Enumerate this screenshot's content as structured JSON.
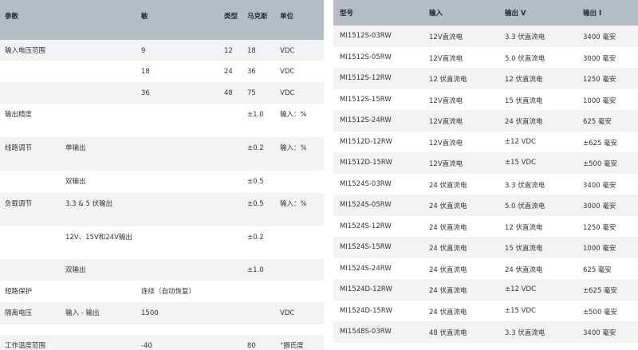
{
  "left_table": {
    "headers": [
      "参数",
      "",
      "敏",
      "类型",
      "马克斯",
      "单位"
    ],
    "rows": [
      [
        "输入电压范围",
        "",
        "9",
        "12",
        "18",
        "VDC"
      ],
      [
        "",
        "",
        "18",
        "24",
        "36",
        "VDC"
      ],
      [
        "",
        "",
        "36",
        "48",
        "75",
        "VDC"
      ],
      [
        "输出精度",
        "",
        "",
        "",
        "±1.0",
        "输入：%"
      ],
      [
        "线路调节",
        "单输出",
        "",
        "",
        "±0.2",
        "输入：%"
      ],
      [
        "",
        "双输出",
        "",
        "",
        "±0.5",
        ""
      ],
      [
        "负载调节",
        "3.3 & 5 伏输出",
        "",
        "",
        "±0.5",
        "输入：%"
      ],
      [
        "",
        "12V、15V和24V输出",
        "",
        "",
        "±0.2",
        ""
      ],
      [
        "",
        "双输出",
        "",
        "",
        "±1.0",
        ""
      ],
      [
        "短路保护",
        "",
        "连续（自动恢复）",
        "",
        "",
        ""
      ],
      [
        "隔离电压",
        "输入 - 输出",
        "1500",
        "",
        "",
        "VDC"
      ],
      [
        "",
        "",
        "",
        "",
        "",
        ""
      ],
      [
        "工作温度范围",
        "",
        "-40",
        "",
        "80",
        "°摄氏度"
      ]
    ]
  },
  "right_table": {
    "headers": [
      "型号",
      "输入",
      "输出 V",
      "输出 I"
    ],
    "rows": [
      [
        "MI1512S-03RW",
        "12V直流电",
        "3.3 伏直流电",
        "3400 毫安"
      ],
      [
        "MI1512S-05RW",
        "12V直流电",
        "5.0 伏直流电",
        "3000 毫安"
      ],
      [
        "MI1512S-12RW",
        "12 伏直流电",
        "12 伏直流电",
        "1250 毫安"
      ],
      [
        "MI1512S-15RW",
        "12V直流电",
        "15 伏直流电",
        "1000 毫安"
      ],
      [
        "MI1512S-24RW",
        "12V直流电",
        "24 伏直流电",
        "625 毫安"
      ],
      [
        "MI1512D-12RW",
        "12V直流电",
        "±12 VDC",
        "±625 毫安"
      ],
      [
        "MI1512D-15RW",
        "12V直流电",
        "±15 VDC",
        "±500 毫安"
      ],
      [
        "MI1524S-03RW",
        "24 伏直流电",
        "3.3 伏直流电",
        "3400 毫安"
      ],
      [
        "MI1524S-05RW",
        "24 伏直流电",
        "5.0 伏直流电",
        "3000 毫安"
      ],
      [
        "MI1524S-12RW",
        "24 伏直流电",
        "12 伏直流电",
        "1250 毫安"
      ],
      [
        "MI1524S-15RW",
        "24 伏直流电",
        "15 伏直流电",
        "1000 毫安"
      ],
      [
        "MI1524S-24RW",
        "24 伏直流电",
        "24 伏直流电",
        "625 毫安"
      ],
      [
        "MI1524D-12RW",
        "24 伏直流电",
        "±12 VDC",
        "±625 毫安"
      ],
      [
        "MI1524D-15RW",
        "24 伏直流电",
        "±15 VDC",
        "±500 毫安"
      ],
      [
        "MI1548S-03RW",
        "48 伏直流电",
        "3.3 伏直流电",
        "3400 毫安"
      ]
    ]
  }
}
